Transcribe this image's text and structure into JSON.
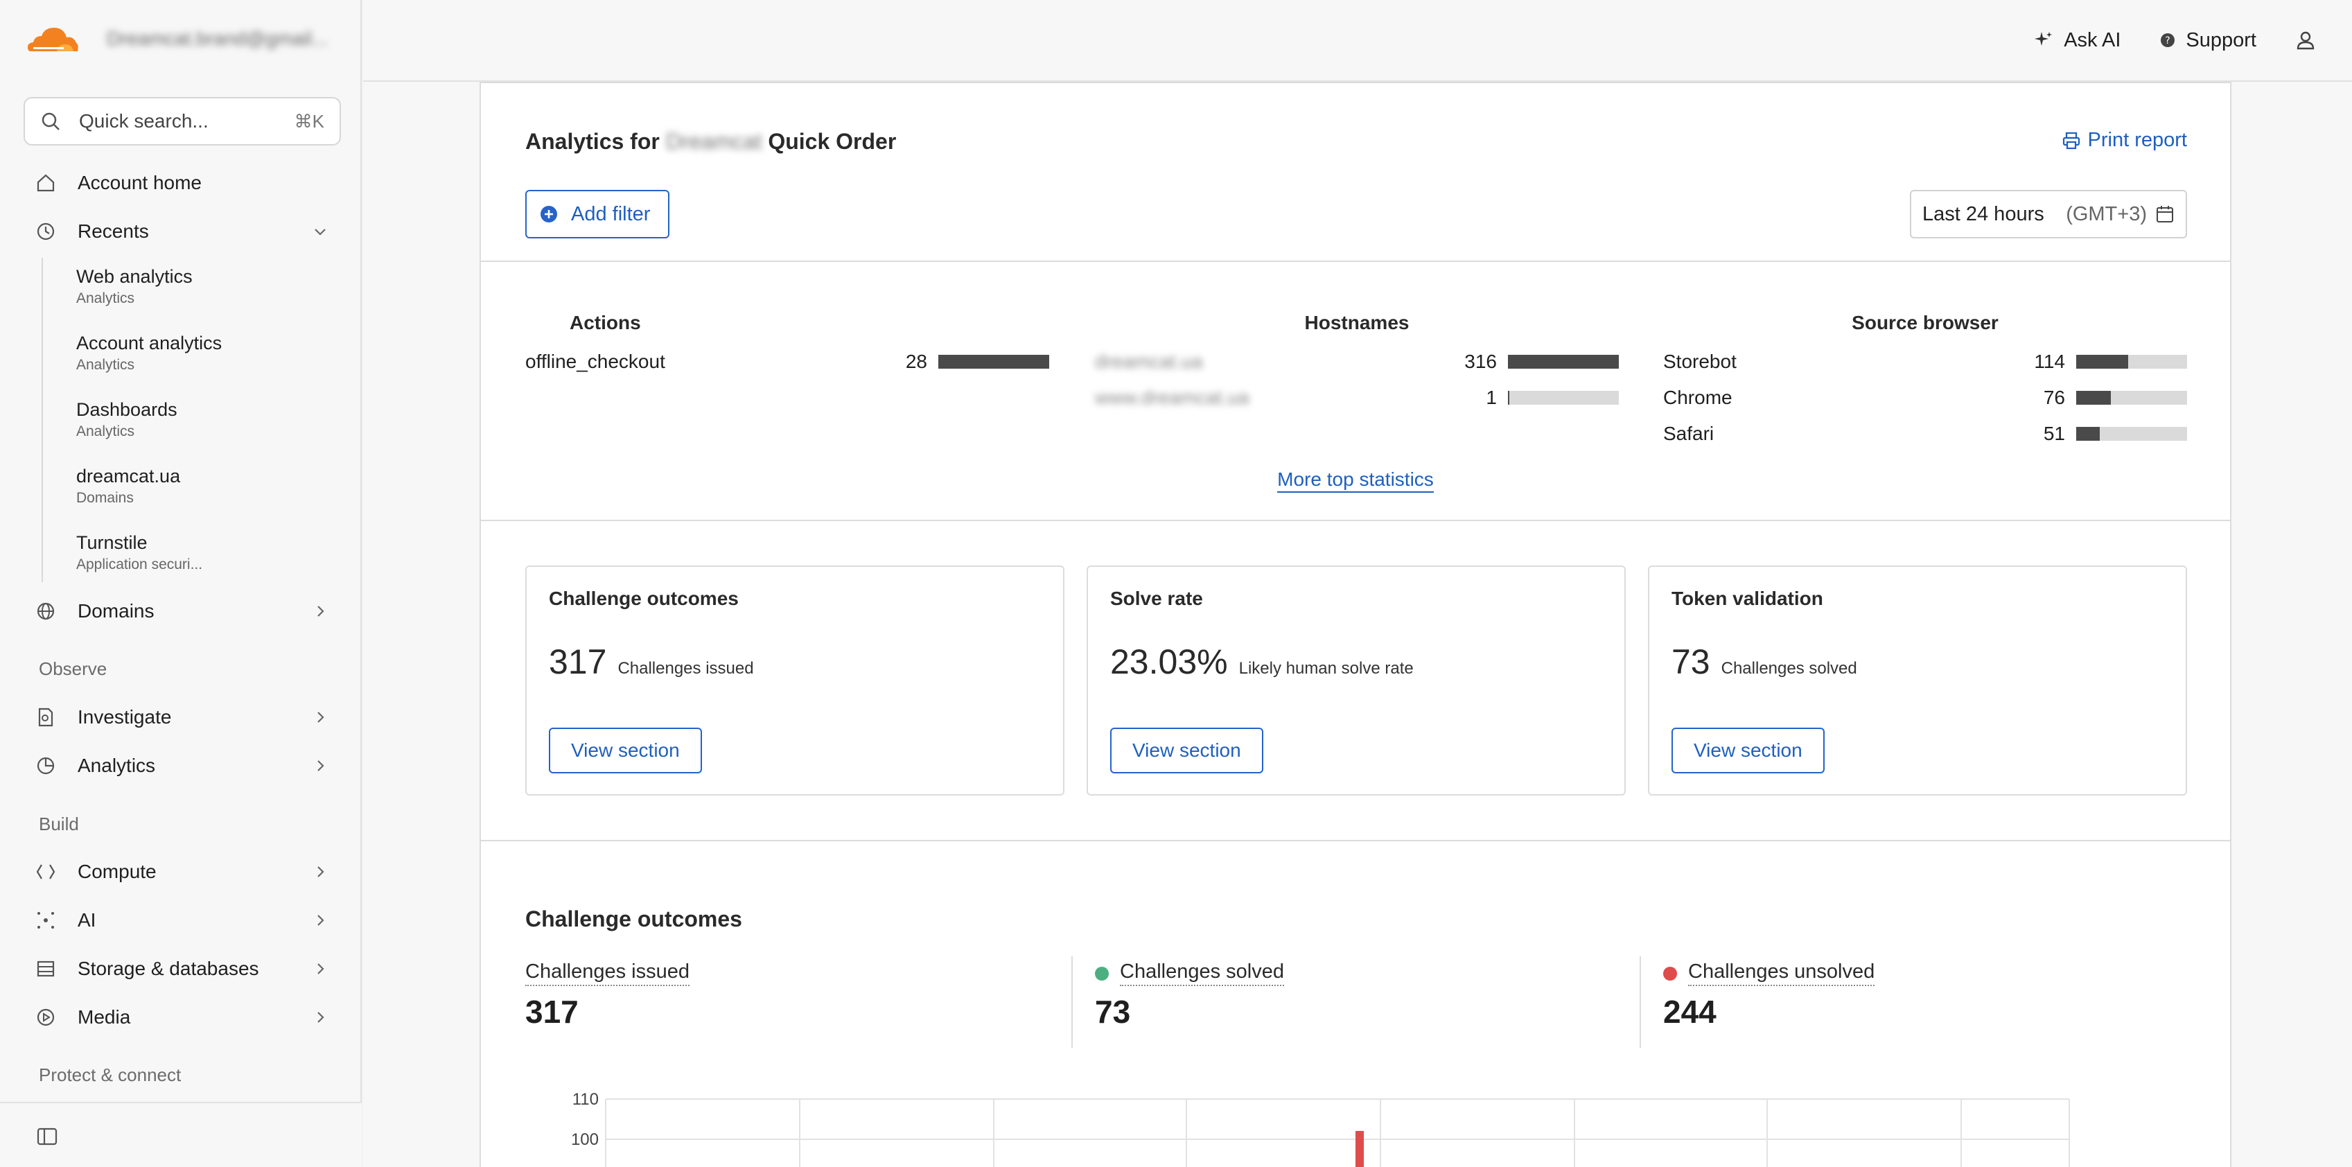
{
  "sidebar": {
    "account_email": "Dreamcat.brand@gmail...",
    "search": {
      "placeholder": "Quick search...",
      "shortcut": "⌘K"
    },
    "account_home": "Account home",
    "recents_label": "Recents",
    "recents": [
      {
        "title": "Web analytics",
        "subtitle": "Analytics"
      },
      {
        "title": "Account analytics",
        "subtitle": "Analytics"
      },
      {
        "title": "Dashboards",
        "subtitle": "Analytics"
      },
      {
        "title": "dreamcat.ua",
        "subtitle": "Domains"
      },
      {
        "title": "Turnstile",
        "subtitle": "Application securi..."
      }
    ],
    "domains_label": "Domains",
    "observe_label": "Observe",
    "investigate_label": "Investigate",
    "analytics_label": "Analytics",
    "build_label": "Build",
    "compute_label": "Compute",
    "ai_label": "AI",
    "storage_label": "Storage & databases",
    "media_label": "Media",
    "protect_label": "Protect & connect"
  },
  "topbar": {
    "ask_ai": "Ask AI",
    "support": "Support"
  },
  "main": {
    "title_prefix": "Analytics for",
    "title_blurred": "Dreamcat",
    "title_suffix": "Quick Order",
    "print_report": "Print report",
    "add_filter": "Add filter",
    "date_range": "Last 24 hours",
    "timezone": "(GMT+3)",
    "top_stats": {
      "actions": {
        "title": "Actions",
        "rows": [
          {
            "label": "offline_checkout",
            "value": "28",
            "fraction": 1.0
          }
        ]
      },
      "hostnames": {
        "title": "Hostnames",
        "rows": [
          {
            "label": "dreamcat.ua",
            "value": "316",
            "fraction": 1.0
          },
          {
            "label": "www.dreamcat.ua",
            "value": "1",
            "fraction": 0.003
          }
        ]
      },
      "browsers": {
        "title": "Source browser",
        "rows": [
          {
            "label": "Storebot",
            "value": "114",
            "fraction": 0.47
          },
          {
            "label": "Chrome",
            "value": "76",
            "fraction": 0.31
          },
          {
            "label": "Safari",
            "value": "51",
            "fraction": 0.21
          }
        ]
      }
    },
    "more_stats": "More top statistics",
    "cards": [
      {
        "title": "Challenge outcomes",
        "value": "317",
        "sub": "Challenges issued",
        "button": "View section"
      },
      {
        "title": "Solve rate",
        "value": "23.03%",
        "sub": "Likely human solve rate",
        "button": "View section"
      },
      {
        "title": "Token validation",
        "value": "73",
        "sub": "Challenges solved",
        "button": "View section"
      }
    ],
    "outcomes": {
      "title": "Challenge outcomes",
      "issued_label": "Challenges issued",
      "issued_value": "317",
      "solved_label": "Challenges solved",
      "solved_value": "73",
      "solved_color": "#4caf82",
      "unsolved_label": "Challenges unsolved",
      "unsolved_value": "244",
      "unsolved_color": "#e04b4b"
    }
  },
  "chart_data": {
    "type": "bar",
    "y_ticks": [
      "110",
      "100"
    ],
    "visible_series_color": "#e04b4b"
  }
}
